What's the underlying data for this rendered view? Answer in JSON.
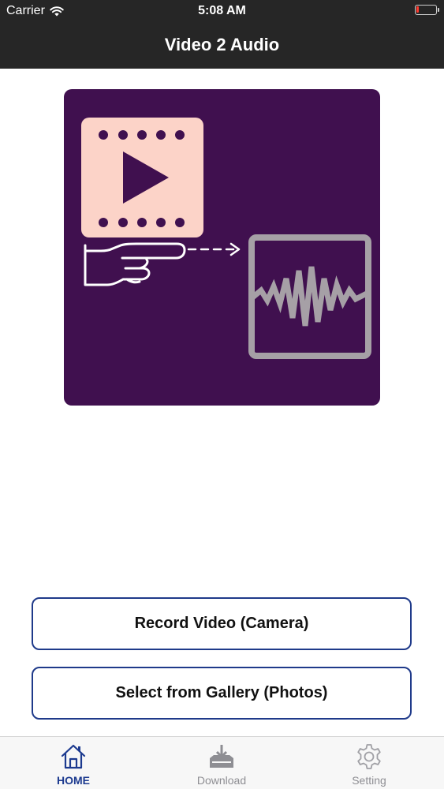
{
  "status_bar": {
    "carrier": "Carrier",
    "time": "5:08 AM",
    "battery_color": "#ff3b30"
  },
  "nav": {
    "title": "Video 2 Audio"
  },
  "artwork": {
    "background": "#40104f",
    "film_color": "#fcd3c8",
    "icons": [
      "film-play-icon",
      "hand-pointing-icon",
      "dashed-arrow-icon",
      "audio-waveform-icon"
    ]
  },
  "buttons": {
    "record_label": "Record Video (Camera)",
    "gallery_label": "Select from Gallery (Photos)",
    "border_color": "#1f3a8a"
  },
  "tabbar": {
    "tabs": [
      {
        "label": "HOME",
        "icon": "home-icon",
        "selected": true
      },
      {
        "label": "Download",
        "icon": "download-icon",
        "selected": false
      },
      {
        "label": "Setting",
        "icon": "gear-icon",
        "selected": false
      }
    ],
    "active_color": "#1c3a8f",
    "inactive_color": "#8e8e93"
  }
}
